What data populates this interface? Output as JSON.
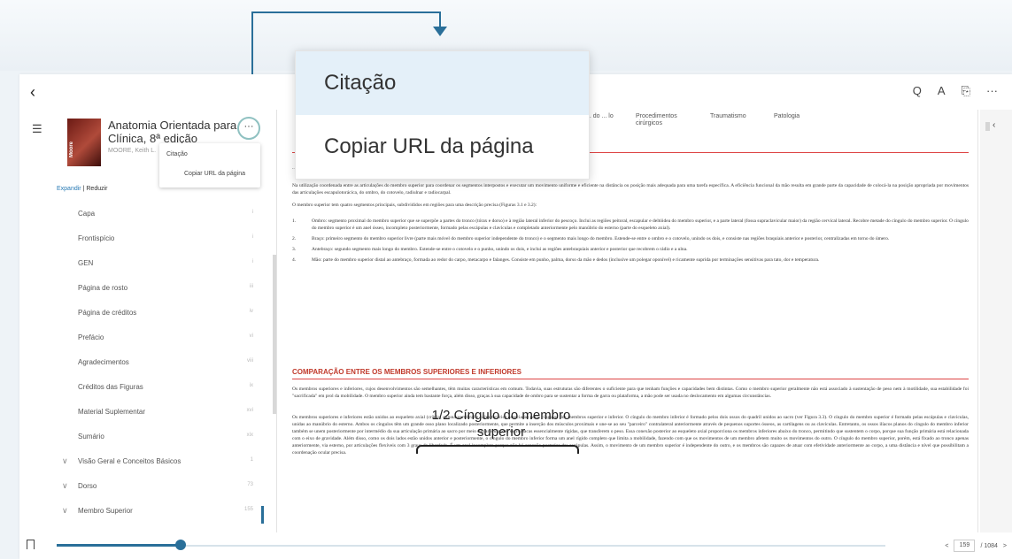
{
  "popup_menu": {
    "items": [
      {
        "label": "Citação"
      },
      {
        "label": "Copiar URL da página"
      }
    ]
  },
  "book": {
    "title": "Anatomia Orientada para Clínica, 8ª edição",
    "author": "MOORE, Keith L.",
    "cover_text": "Moore",
    "menu": [
      "Citação",
      "Copiar URL da página"
    ],
    "more_label": "···"
  },
  "sidebar": {
    "expand_label": "Expandir",
    "collapse_label": "Reduzir",
    "separator": "|",
    "toc": [
      {
        "label": "Capa",
        "page": "i",
        "chevron": ""
      },
      {
        "label": "Frontispício",
        "page": "i",
        "chevron": ""
      },
      {
        "label": "GEN",
        "page": "i",
        "chevron": ""
      },
      {
        "label": "Página de rosto",
        "page": "iii",
        "chevron": ""
      },
      {
        "label": "Página de créditos",
        "page": "iv",
        "chevron": ""
      },
      {
        "label": "Prefácio",
        "page": "vi",
        "chevron": ""
      },
      {
        "label": "Agradecimentos",
        "page": "viii",
        "chevron": ""
      },
      {
        "label": "Créditos das Figuras",
        "page": "ix",
        "chevron": ""
      },
      {
        "label": "Material Suplementar",
        "page": "xvi",
        "chevron": ""
      },
      {
        "label": "Sumário",
        "page": "xix",
        "chevron": ""
      },
      {
        "label": "Visão Geral e Conceitos Básicos",
        "page": "1",
        "chevron": "∨"
      },
      {
        "label": "Dorso",
        "page": "73",
        "chevron": "∨"
      },
      {
        "label": "Membro Superior",
        "page": "155",
        "chevron": "∨"
      }
    ]
  },
  "toolbar": {
    "search": "Q",
    "font": "A",
    "bookmark": "⎘",
    "more": "···",
    "back": "‹"
  },
  "document": {
    "tabs": [
      "... do ... lo",
      "Procedimentos cirúrgicos",
      "Traumatismo",
      "Patologia"
    ],
    "para1": "... e executar atividades motoras finas (manipulação). Essas qualidades são mais acentuadas na mão ao realizar atividades como ...",
    "para2": "Na utilização coordenada entre as articulações do membro superior para coordenar os segmentos interpostos e executar um movimento uniforme e eficiente na distância ou posição mais adequada para uma tarefa específica. A eficiência funcional da mão resulta em grande parte da capacidade de colocá-la na posição apropriada por movimentos das articulações escapulotorácica, do ombro, do cotovelo, radiulnar e radiocarpal.",
    "para3": "O membro superior tem quatro segmentos principais, subdivididos em regiões para uma descrição precisa (Figuras 3.1 e 3.2):",
    "list": [
      {
        "num": "1.",
        "text": "Ombro: segmento proximal do membro superior que se superpõe a partes do tronco (tórax e dorso) e à região lateral inferior do pescoço. Inclui as regiões peitoral, escapular e deltóidea do membro superior, e a parte lateral (fossa supraclavicular maior) da região cervical lateral. Recobre metade do cíngulo do membro superior. O cíngulo do membro superior é um anel ósseo, incompleto posteriormente, formado pelas escápulas e clavículas e completado anteriormente pelo manúbrio do esterno (parte do esqueleto axial)."
      },
      {
        "num": "2.",
        "text": "Braço: primeiro segmento do membro superior livre (parte mais móvel do membro superior independente do tronco) e o segmento mais longo do membro. Estende-se entre o ombro e o cotovelo, unindo os dois, e consiste nas regiões braquiais anterior e posterior, centralizadas em torno do úmero."
      },
      {
        "num": "3.",
        "text": "Antebraço: segundo segmento mais longo do membro. Estende-se entre o cotovelo e o punho, unindo os dois, e inclui as regiões antebraquiais anterior e posterior que recobrem o rádio e a ulna."
      },
      {
        "num": "4.",
        "text": "Mão: parte do membro superior distal ao antebraço, formada ao redor do carpo, metacarpo e falanges. Consiste em punho, palma, dorso da mão e dedos (inclusive um polegar oponível) e ricamente suprida por terminações sensitivas para tato, dor e temperatura."
      }
    ],
    "section_title": "COMPARAÇÃO ENTRE OS MEMBROS SUPERIORES E INFERIORES",
    "para4": "Os membros superiores e inferiores, cujos desenvolvimentos são semelhantes, têm muitas características em comum. Todavia, suas estruturas são diferentes o suficiente para que tenham funções e capacidades bem distintas. Como o membro superior geralmente não está associado à sustentação de peso nem à motilidade, sua estabilidade foi \"sacrificada\" em prol da mobilidade. O membro superior ainda tem bastante força, além disso, graças à sua capacidade de ombro para se sustentar a forma de garra ou plataforma, a mão pode ser usada no deslocamento em algumas circunstâncias.",
    "para5": "Os membros superiores e inferiores estão unidos ao esqueleto axial (crânio, coluna vertebral e caixa torácica associada) pelos cíngulos dos membros superior e inferior. O cíngulo do membro inferior é formado pelos dois ossos do quadril unidos ao sacro (ver Figura 3.3). O cíngulo do membro superior é formado pelas escápulas e clavículas, unidas ao manúbrio do esterno. Ambos os cíngulos têm um grande osso plano localizado posteriormente, que permite a inserção dos músculos proximais e une-se ao seu \"parceiro\" contralateral anteriormente através de pequenos suportes ósseos, as cartilagens ou as clavículas. Entretanto, os ossos ilíacos planos do cíngulo do membro inferior também se unem posteriormente por intermédio da sua articulação primária ao sacro por meio das articulações sacroilíacas essencialmente rígidas, que transferem o peso. Essa conexão posterior ao esqueleto axial proporciona os membros inferiores abaixo do tronco, permitindo que sustentem o corpo, porque sua função primária está relacionada com o eixo de gravidade. Além disso, como os dois lados estão unidos anterior e posteriormente, o cíngulo do membro inferior forma um anel rígido completo que limita a mobilidade, fazendo com que os movimentos de um membro afetem muito os movimentos do outro. O cíngulo do membro superior, porém, está fixado ao tronco apenas anteriormente, via esterno, por articulações flexíveis com 3 graus de liberdade. É um anel incompleto porque não há conexão posterior das escápulas. Assim, o movimento de um membro superior é independente do outro, e os membros são capazes de atuar com efetividade anteriormente ao corpo, a uma distância e nível que possibilitam a coordenação ocular precisa.",
    "annotation_caption": "1/2 Cíngulo do membro superior"
  },
  "right_column": {
    "chevron": "‹"
  },
  "bottom_bar": {
    "progress_fraction": 0.15,
    "page_current": "159",
    "page_total": "/ 1084",
    "prev": "<",
    "next": ">"
  },
  "colors": {
    "accent": "#2a6f99",
    "section_red": "#c0392b",
    "popup_active": "#e4f0f9"
  }
}
